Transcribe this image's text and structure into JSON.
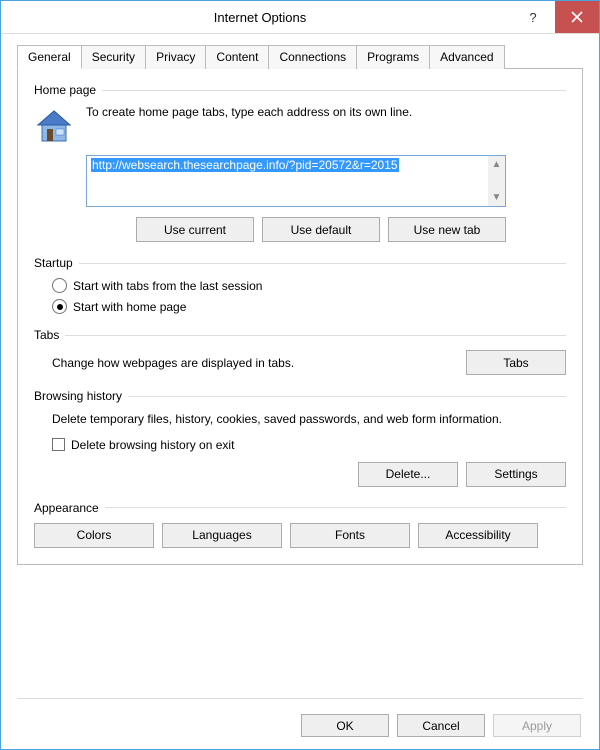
{
  "window": {
    "title": "Internet Options"
  },
  "tabs": [
    "General",
    "Security",
    "Privacy",
    "Content",
    "Connections",
    "Programs",
    "Advanced"
  ],
  "activeTab": "General",
  "homepage": {
    "label": "Home page",
    "desc": "To create home page tabs, type each address on its own line.",
    "url": "http://websearch.thesearchpage.info/?pid=20572&r=2015",
    "buttons": {
      "current": "Use current",
      "default": "Use default",
      "newtab": "Use new tab"
    }
  },
  "startup": {
    "label": "Startup",
    "opt1": "Start with tabs from the last session",
    "opt2": "Start with home page",
    "selected": "home"
  },
  "tabsSection": {
    "label": "Tabs",
    "desc": "Change how webpages are displayed in tabs.",
    "button": "Tabs"
  },
  "history": {
    "label": "Browsing history",
    "desc": "Delete temporary files, history, cookies, saved passwords, and web form information.",
    "checkbox": "Delete browsing history on exit",
    "deleteBtn": "Delete...",
    "settingsBtn": "Settings"
  },
  "appearance": {
    "label": "Appearance",
    "colors": "Colors",
    "languages": "Languages",
    "fonts": "Fonts",
    "accessibility": "Accessibility"
  },
  "dialogButtons": {
    "ok": "OK",
    "cancel": "Cancel",
    "apply": "Apply"
  }
}
